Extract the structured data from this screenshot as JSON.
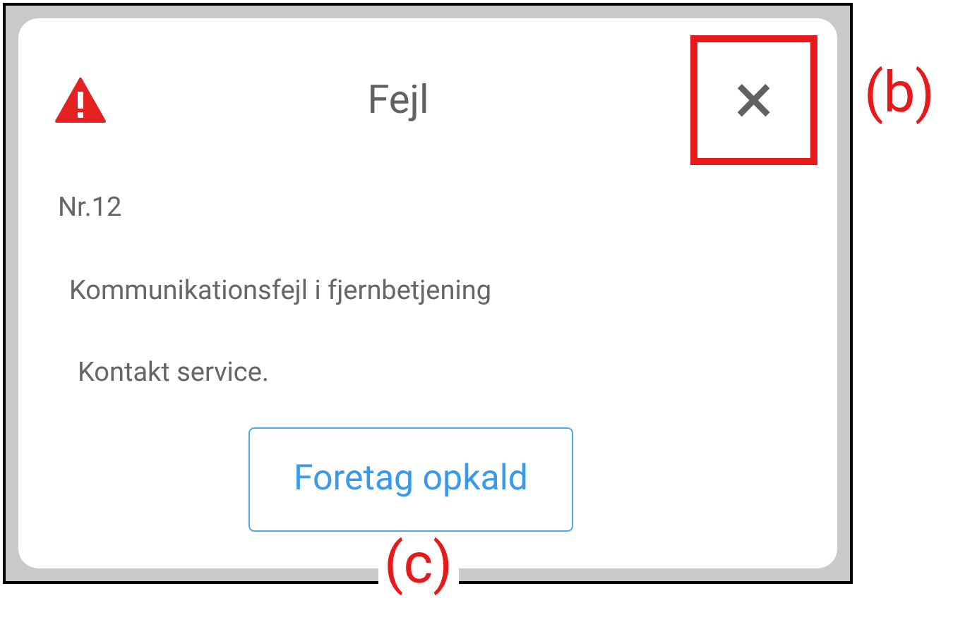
{
  "dialog": {
    "title": "Fejl",
    "close": {
      "label": "×",
      "highlighted": true
    },
    "lines": [
      {
        "text": "Nr.12"
      },
      {
        "text": "Kommunikationsfejl i fjernbetjening"
      },
      {
        "text": "Kontakt service."
      }
    ],
    "button": "Foretag opkald"
  },
  "annotations": [
    {
      "label": "(b)"
    },
    {
      "label": "(c)"
    }
  ]
}
